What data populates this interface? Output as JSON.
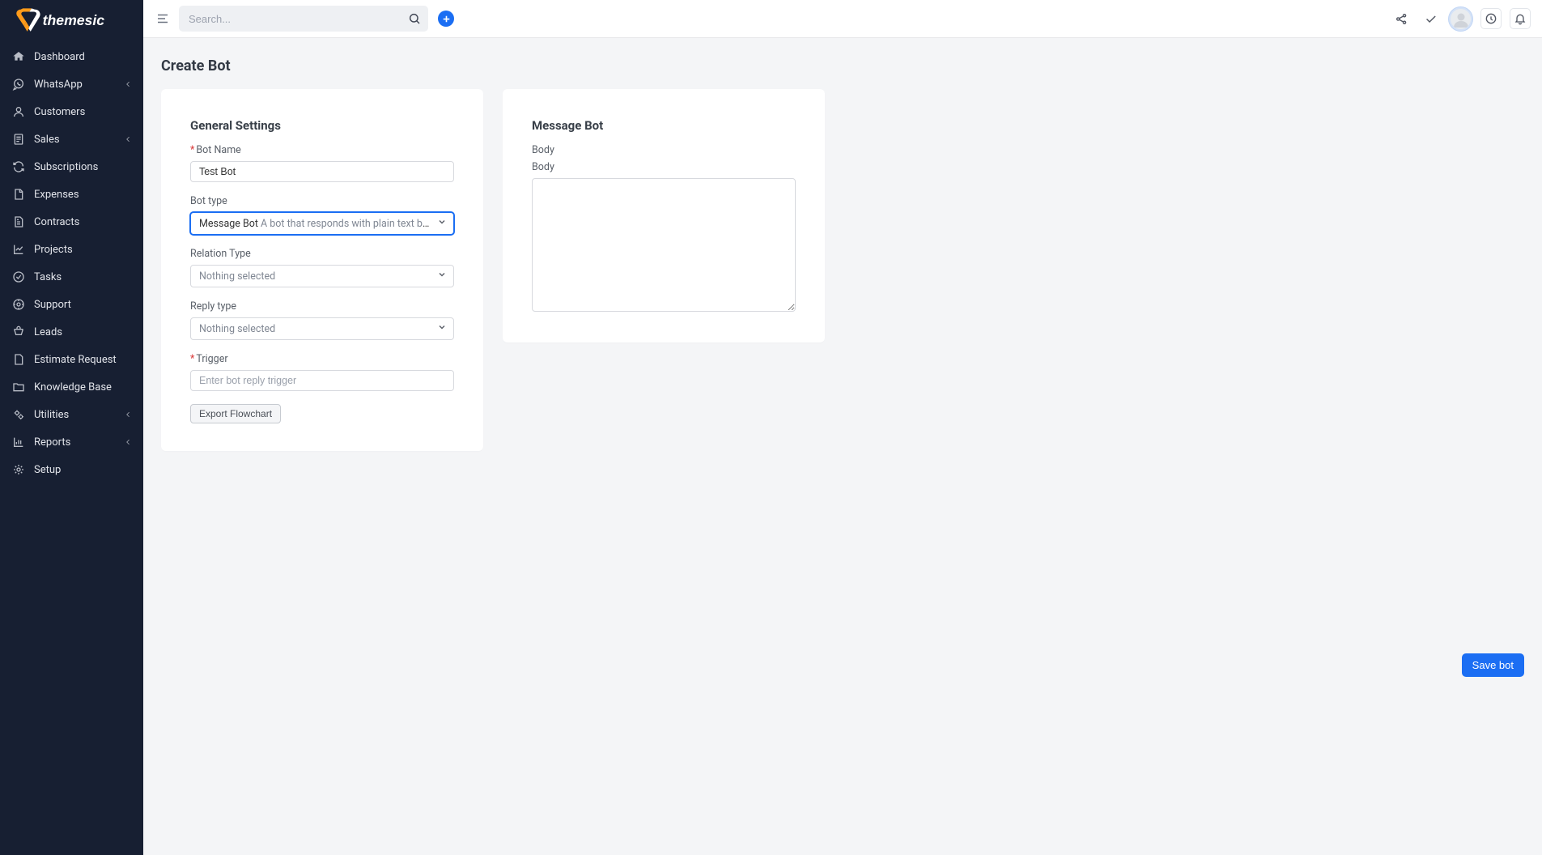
{
  "brand": {
    "name": "themesic"
  },
  "sidebar": {
    "items": [
      {
        "label": "Dashboard",
        "icon": "home",
        "caret": false
      },
      {
        "label": "WhatsApp",
        "icon": "whatsapp",
        "caret": true
      },
      {
        "label": "Customers",
        "icon": "user",
        "caret": false
      },
      {
        "label": "Sales",
        "icon": "doc-lines",
        "caret": true
      },
      {
        "label": "Subscriptions",
        "icon": "refresh",
        "caret": false
      },
      {
        "label": "Expenses",
        "icon": "file",
        "caret": false
      },
      {
        "label": "Contracts",
        "icon": "file-text",
        "caret": false
      },
      {
        "label": "Projects",
        "icon": "chart",
        "caret": false
      },
      {
        "label": "Tasks",
        "icon": "check-circle",
        "caret": false
      },
      {
        "label": "Support",
        "icon": "help",
        "caret": false
      },
      {
        "label": "Leads",
        "icon": "leads",
        "caret": false
      },
      {
        "label": "Estimate Request",
        "icon": "file-blank",
        "caret": false
      },
      {
        "label": "Knowledge Base",
        "icon": "folder",
        "caret": false
      },
      {
        "label": "Utilities",
        "icon": "gears",
        "caret": true
      },
      {
        "label": "Reports",
        "icon": "bar-chart",
        "caret": true
      },
      {
        "label": "Setup",
        "icon": "gear",
        "caret": false
      }
    ]
  },
  "topbar": {
    "search_placeholder": "Search..."
  },
  "page": {
    "title": "Create Bot"
  },
  "general": {
    "title": "General Settings",
    "labels": {
      "bot_name": "Bot Name",
      "bot_type": "Bot type",
      "relation_type": "Relation Type",
      "reply_type": "Reply type",
      "trigger": "Trigger"
    },
    "bot_name_value": "Test Bot",
    "bot_type_value": "Message Bot",
    "bot_type_desc": "A bot that responds with plain text based on s…",
    "relation_placeholder": "Nothing selected",
    "reply_placeholder": "Nothing selected",
    "trigger_placeholder": "Enter bot reply trigger",
    "export_label": "Export Flowchart"
  },
  "message": {
    "title": "Message Bot",
    "body1_label": "Body",
    "body2_label": "Body",
    "body_value": ""
  },
  "actions": {
    "save": "Save bot"
  }
}
